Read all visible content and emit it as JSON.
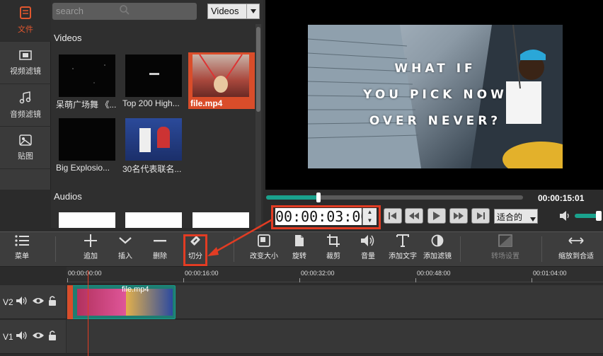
{
  "nav": {
    "items": [
      {
        "label": "文件",
        "icon": "file-icon"
      },
      {
        "label": "视频滤镜",
        "icon": "video-filter-icon"
      },
      {
        "label": "音频滤镜",
        "icon": "audio-filter-icon"
      },
      {
        "label": "贴图",
        "icon": "sticker-icon"
      }
    ]
  },
  "library": {
    "search_placeholder": "search",
    "category": "Videos",
    "videos_heading": "Videos",
    "audios_heading": "Audios",
    "videos": [
      {
        "label": "呆萌广场舞 《..."
      },
      {
        "label": "Top 200 High..."
      },
      {
        "label": "file.mp4"
      },
      {
        "label": "Big Explosio..."
      },
      {
        "label": "30名代表联名..."
      }
    ]
  },
  "player": {
    "overlay_lines": [
      "WHAT IF",
      "YOU PICK NOW",
      "OVER NEVER?"
    ],
    "duration": "00:00:15:01",
    "timecode": "00:00:03:00",
    "zoom": "适合的",
    "progress_percent": 20
  },
  "toolbar": {
    "menu": "菜单",
    "add": "追加",
    "insert": "插入",
    "delete": "删除",
    "split": "切分",
    "resize": "改变大小",
    "rotate": "旋转",
    "crop": "裁剪",
    "volume": "音量",
    "add_text": "添加文字",
    "add_filter": "添加滤镜",
    "transition": "转场设置",
    "zoom_fit": "缩放到合适"
  },
  "timeline": {
    "ruler": [
      "00:00:00:00",
      "00:00:16:00",
      "00:00:32:00",
      "00:00:48:00",
      "00:01:04:00"
    ],
    "tracks": [
      {
        "name": "V2"
      },
      {
        "name": "V1"
      }
    ],
    "clip_name": "file.mp4"
  },
  "colors": {
    "accent": "#e2572e",
    "teal": "#1aa28d",
    "highlight": "#e23c23"
  }
}
